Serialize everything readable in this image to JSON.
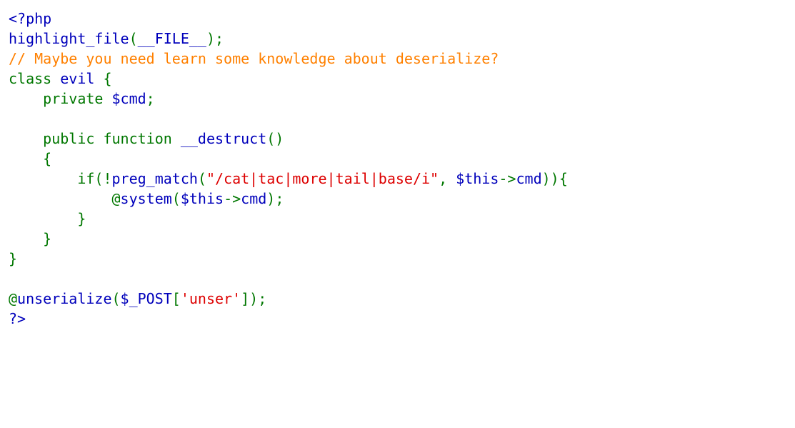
{
  "source_lines": [
    [
      {
        "t": "<?php",
        "c": "html"
      }
    ],
    [
      {
        "t": "highlight_file",
        "c": "default"
      },
      {
        "t": "(",
        "c": "keyword"
      },
      {
        "t": "__FILE__",
        "c": "default"
      },
      {
        "t": ");",
        "c": "keyword"
      }
    ],
    [
      {
        "t": "// Maybe you need learn some knowledge about deserialize?",
        "c": "comment"
      }
    ],
    [
      {
        "t": "class ",
        "c": "keyword"
      },
      {
        "t": "evil ",
        "c": "default"
      },
      {
        "t": "{",
        "c": "keyword"
      }
    ],
    [
      {
        "t": "    ",
        "c": "keyword"
      },
      {
        "t": "private ",
        "c": "keyword"
      },
      {
        "t": "$cmd",
        "c": "default"
      },
      {
        "t": ";",
        "c": "keyword"
      }
    ],
    [
      {
        "t": "",
        "c": "keyword"
      }
    ],
    [
      {
        "t": "    public function ",
        "c": "keyword"
      },
      {
        "t": "__destruct",
        "c": "default"
      },
      {
        "t": "()",
        "c": "keyword"
      }
    ],
    [
      {
        "t": "    {",
        "c": "keyword"
      }
    ],
    [
      {
        "t": "        if(!",
        "c": "keyword"
      },
      {
        "t": "preg_match",
        "c": "default"
      },
      {
        "t": "(",
        "c": "keyword"
      },
      {
        "t": "\"/cat|tac|more|tail|base/i\"",
        "c": "string"
      },
      {
        "t": ", ",
        "c": "keyword"
      },
      {
        "t": "$this",
        "c": "default"
      },
      {
        "t": "->",
        "c": "keyword"
      },
      {
        "t": "cmd",
        "c": "default"
      },
      {
        "t": ")){",
        "c": "keyword"
      }
    ],
    [
      {
        "t": "            @",
        "c": "keyword"
      },
      {
        "t": "system",
        "c": "default"
      },
      {
        "t": "(",
        "c": "keyword"
      },
      {
        "t": "$this",
        "c": "default"
      },
      {
        "t": "->",
        "c": "keyword"
      },
      {
        "t": "cmd",
        "c": "default"
      },
      {
        "t": ");",
        "c": "keyword"
      }
    ],
    [
      {
        "t": "        }",
        "c": "keyword"
      }
    ],
    [
      {
        "t": "    }",
        "c": "keyword"
      }
    ],
    [
      {
        "t": "}",
        "c": "keyword"
      }
    ],
    [
      {
        "t": "",
        "c": "keyword"
      }
    ],
    [
      {
        "t": "@",
        "c": "keyword"
      },
      {
        "t": "unserialize",
        "c": "default"
      },
      {
        "t": "(",
        "c": "keyword"
      },
      {
        "t": "$_POST",
        "c": "default"
      },
      {
        "t": "[",
        "c": "keyword"
      },
      {
        "t": "'unser'",
        "c": "string"
      },
      {
        "t": "]);",
        "c": "keyword"
      }
    ],
    [
      {
        "t": "?>",
        "c": "html"
      }
    ]
  ],
  "colors": {
    "html": "#000BB",
    "default": "#0000BB",
    "keyword": "#007700",
    "comment": "#FF8000",
    "string": "#DD0000"
  }
}
